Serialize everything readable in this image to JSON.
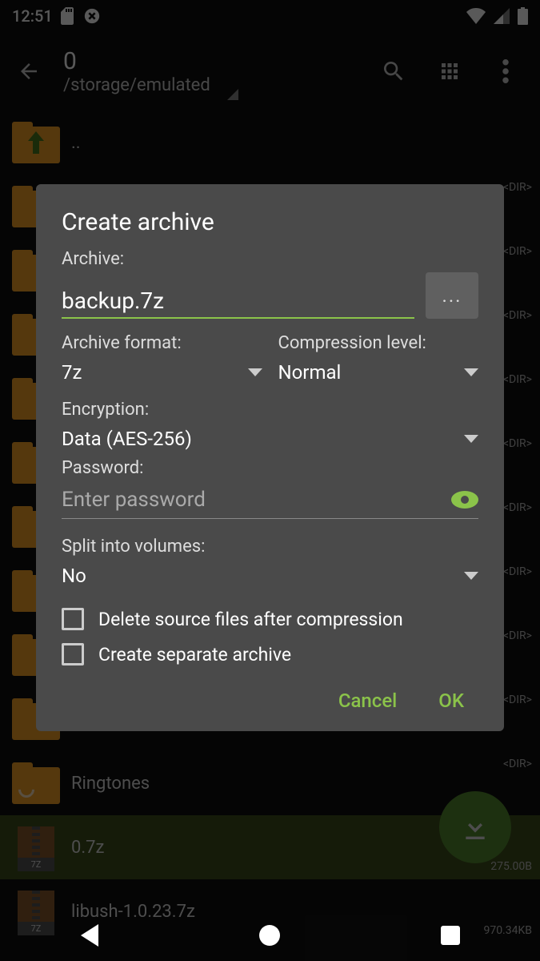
{
  "status": {
    "time": "12:51"
  },
  "appbar": {
    "title_line1": "0",
    "title_line2": "/storage/emulated"
  },
  "list": {
    "up_label": "..",
    "ringtones_label": "Ringtones",
    "dir_tag": "<DIR>",
    "file1": {
      "name": "0.7z",
      "size": "275.00B"
    },
    "file2": {
      "name": "libush-1.0.23.7z",
      "size": "970.34KB"
    },
    "archive_ext": "7Z"
  },
  "dialog": {
    "title": "Create archive",
    "archive_label": "Archive:",
    "archive_value": "backup.7z",
    "browse": "...",
    "format_label": "Archive format:",
    "format_value": "7z",
    "level_label": "Compression level:",
    "level_value": "Normal",
    "encryption_label": "Encryption:",
    "encryption_value": "Data (AES-256)",
    "password_label": "Password:",
    "password_placeholder": "Enter password",
    "split_label": "Split into volumes:",
    "split_value": "No",
    "delete_label": "Delete source files after compression",
    "separate_label": "Create separate archive",
    "cancel": "Cancel",
    "ok": "OK"
  }
}
